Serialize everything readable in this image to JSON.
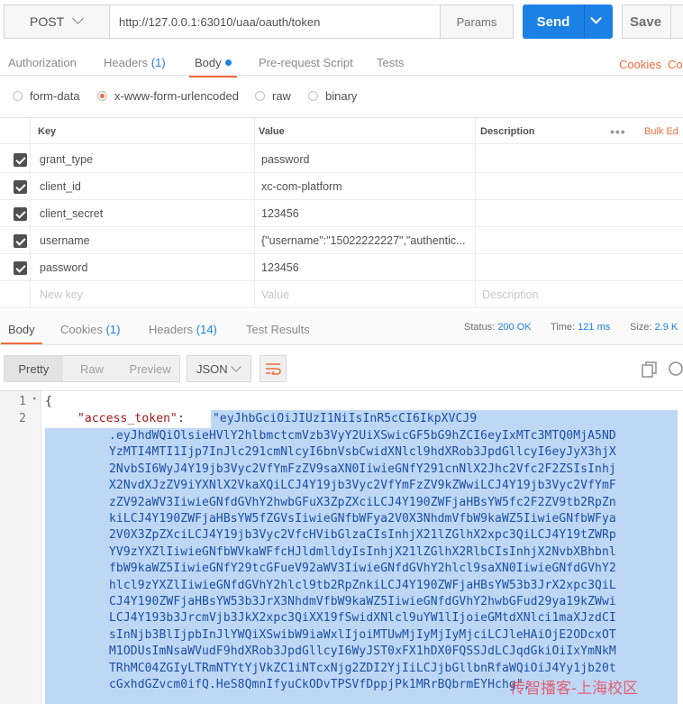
{
  "request": {
    "method": "POST",
    "url": "http://127.0.0.1:63010/uaa/oauth/token",
    "params_label": "Params",
    "send_label": "Send",
    "save_label": "Save"
  },
  "request_tabs": {
    "authorization": "Authorization",
    "headers": "Headers",
    "headers_count": "(1)",
    "body": "Body",
    "prerequest": "Pre-request Script",
    "tests": "Tests",
    "cookies": "Cookies",
    "code": "Co"
  },
  "body_types": {
    "form_data": "form-data",
    "urlencoded": "x-www-form-urlencoded",
    "raw": "raw",
    "binary": "binary"
  },
  "kv_table": {
    "headers": {
      "key": "Key",
      "value": "Value",
      "description": "Description",
      "bulk_edit": "Bulk Ed"
    },
    "rows": [
      {
        "key": "grant_type",
        "value": "password"
      },
      {
        "key": "client_id",
        "value": "xc-com-platform"
      },
      {
        "key": "client_secret",
        "value": "123456"
      },
      {
        "key": "username",
        "value": "{\"username\":\"15022222227\",\"authentic..."
      },
      {
        "key": "password",
        "value": "123456"
      }
    ],
    "placeholders": {
      "key": "New key",
      "value": "Value",
      "description": "Description"
    }
  },
  "response_tabs": {
    "body": "Body",
    "cookies": "Cookies",
    "cookies_count": "(1)",
    "headers": "Headers",
    "headers_count": "(14)",
    "test_results": "Test Results"
  },
  "response_status": {
    "status_label": "Status:",
    "status_value": "200 OK",
    "time_label": "Time:",
    "time_value": "121 ms",
    "size_label": "Size:",
    "size_value": "2.9 K"
  },
  "viewer": {
    "modes": [
      "Pretty",
      "Raw",
      "Preview"
    ],
    "active_mode": "Pretty",
    "format": "JSON"
  },
  "code": {
    "line_numbers": [
      "1",
      "2"
    ],
    "line1": "{",
    "key": "\"access_token\"",
    "colon": ": ",
    "value_first": "\"eyJhbGciOiJIUzI1NiIsInR5cCI6IkpXVCJ9",
    "value_lines": [
      ".eyJhdWQiOlsieHVlY2hlbmctcmVzb3VyY2UiXSwicGF5bG9hZCI6eyIxMTc3MTQ0MjA5ND",
      "YzMTI4MTI1Ijp7InJlc291cmNlcyI6bnVsbCwidXNlcl9hdXRob3JpdGllcyI6eyJyX3hjX",
      "2NvbSI6WyJ4Y19jb3Vyc2VfYmFzZV9saXN0IiwieGNfY291cnNlX2Jhc2Vfc2F2ZSIsInhj",
      "X2NvdXJzZV9iYXNlX2VkaXQiLCJ4Y19jb3Vyc2VfYmFzZV9kZWwiLCJ4Y19jb3Vyc2VfYmF",
      "zZV92aWV3IiwieGNfdGVhY2hwbGFuX3ZpZXciLCJ4Y190ZWFjaHBsYW5fc2F2ZV9tb2RpZn",
      "kiLCJ4Y190ZWFjaHBsYW5fZGVsIiwieGNfbWFya2V0X3NhdmVfbW9kaWZ5IiwieGNfbWFya",
      "2V0X3ZpZXciLCJ4Y19jb3Vyc2VfcHVibGlzaCIsInhjX21lZGlhX2xpc3QiLCJ4Y19tZWRp",
      "YV9zYXZlIiwieGNfbWVkaWFfcHJldmlldyIsInhjX21lZGlhX2RlbCIsInhjX2NvbXBhbnl",
      "fbW9kaWZ5IiwieGNfY29tcGFueV92aWV3IiwieGNfdGVhY2hlcl9saXN0IiwieGNfdGVhY2",
      "hlcl9zYXZlIiwieGNfdGVhY2hlcl9tb2RpZnkiLCJ4Y190ZWFjaHBsYW53b3JrX2xpc3QiL",
      "CJ4Y190ZWFjaHBsYW53b3JrX3NhdmVfbW9kaWZ5IiwieGNfdGVhY2hwbGFud29ya19kZWwi",
      "LCJ4Y193b3JrcmVjb3JkX2xpc3QiXX19fSwidXNlcl9uYW1lIjoieGMtdXNlci1maXJzdCI",
      "sInNjb3BlIjpbInJlYWQiXSwibW9iaWxlIjoiMTUwMjIyMjIyMjciLCJleHAiOjE2ODcxOT",
      "M1ODUsImNsaWVudF9hdXRob3JpdGllcyI6WyJST0xFX1hDX0FQSSJdLCJqdGkiOiIxYmNkM",
      "TRhMC04ZGIyLTRmNTYtYjVkZC1iNTcxNjg2ZDI2YjIiLCJjbGllbnRfaWQiOiJ4Yy1jb20t",
      "cGxhdGZvcm0ifQ.HeS8QmnIfyuCkODvTPSVfDppjPk1MRrBQbrmEYHchg\","
    ],
    "watermark": "传智播客-上海校区"
  }
}
